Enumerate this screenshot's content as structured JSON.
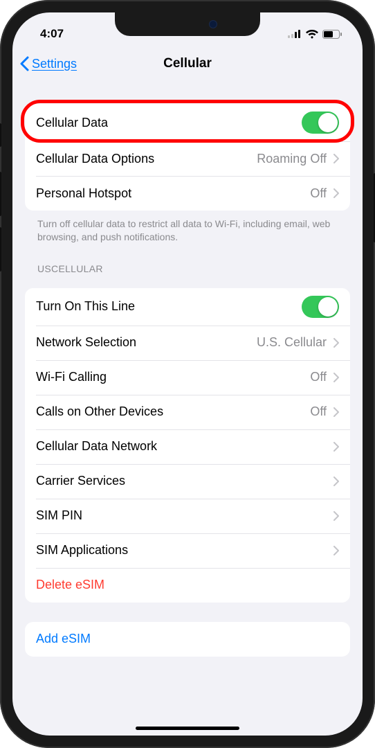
{
  "status": {
    "time": "4:07"
  },
  "nav": {
    "back_label": "Settings",
    "title": "Cellular"
  },
  "section1": {
    "cellular_data": {
      "label": "Cellular Data",
      "toggled": true
    },
    "cellular_data_options": {
      "label": "Cellular Data Options",
      "value": "Roaming Off"
    },
    "personal_hotspot": {
      "label": "Personal Hotspot",
      "value": "Off"
    },
    "footer": "Turn off cellular data to restrict all data to Wi-Fi, including email, web browsing, and push notifications."
  },
  "carrier_header": "USCELLULAR",
  "section2": {
    "turn_on_line": {
      "label": "Turn On This Line",
      "toggled": true
    },
    "network_selection": {
      "label": "Network Selection",
      "value": "U.S. Cellular"
    },
    "wifi_calling": {
      "label": "Wi-Fi Calling",
      "value": "Off"
    },
    "calls_other": {
      "label": "Calls on Other Devices",
      "value": "Off"
    },
    "cellular_data_network": {
      "label": "Cellular Data Network"
    },
    "carrier_services": {
      "label": "Carrier Services"
    },
    "sim_pin": {
      "label": "SIM PIN"
    },
    "sim_applications": {
      "label": "SIM Applications"
    },
    "delete_esim": {
      "label": "Delete eSIM"
    }
  },
  "section3": {
    "add_esim": {
      "label": "Add eSIM"
    }
  },
  "colors": {
    "accent": "#007aff",
    "toggle_on": "#34c759",
    "destructive": "#ff3b30",
    "highlight": "#ff0000"
  }
}
